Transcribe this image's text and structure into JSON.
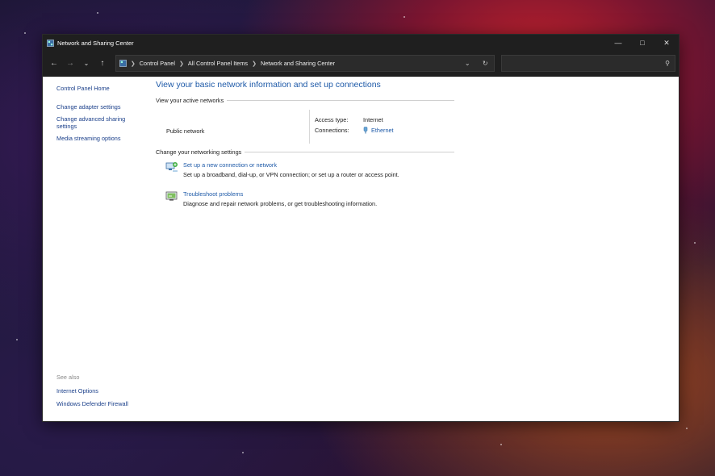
{
  "window": {
    "title": "Network and Sharing Center"
  },
  "address": {
    "crumbs": [
      "Control Panel",
      "All Control Panel Items",
      "Network and Sharing Center"
    ],
    "search_placeholder": ""
  },
  "sidebar": {
    "home": "Control Panel Home",
    "links": [
      "Change adapter settings",
      "Change advanced sharing settings",
      "Media streaming options"
    ]
  },
  "see_also": {
    "label": "See also",
    "links": [
      "Internet Options",
      "Windows Defender Firewall"
    ]
  },
  "main": {
    "heading": "View your basic network information and set up connections",
    "active_networks_title": "View your active networks",
    "network_name": "Public network",
    "access_type_label": "Access type:",
    "access_type_value": "Internet",
    "connections_label": "Connections:",
    "connections_value": "Ethernet",
    "change_settings_title": "Change your networking settings",
    "tasks": [
      {
        "link": "Set up a new connection or network",
        "desc": "Set up a broadband, dial-up, or VPN connection; or set up a router or access point."
      },
      {
        "link": "Troubleshoot problems",
        "desc": "Diagnose and repair network problems, or get troubleshooting information."
      }
    ]
  },
  "colors": {
    "link": "#1e5aa8",
    "titlebar": "#1f1f1f"
  }
}
